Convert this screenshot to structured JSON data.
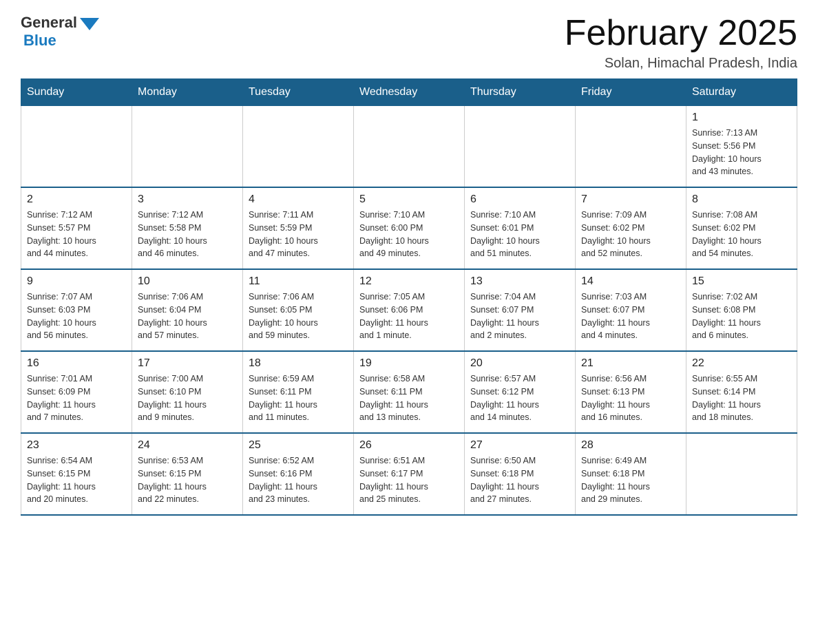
{
  "logo": {
    "general": "General",
    "blue": "Blue"
  },
  "title": "February 2025",
  "subtitle": "Solan, Himachal Pradesh, India",
  "days_of_week": [
    "Sunday",
    "Monday",
    "Tuesday",
    "Wednesday",
    "Thursday",
    "Friday",
    "Saturday"
  ],
  "weeks": [
    [
      {
        "day": "",
        "info": ""
      },
      {
        "day": "",
        "info": ""
      },
      {
        "day": "",
        "info": ""
      },
      {
        "day": "",
        "info": ""
      },
      {
        "day": "",
        "info": ""
      },
      {
        "day": "",
        "info": ""
      },
      {
        "day": "1",
        "info": "Sunrise: 7:13 AM\nSunset: 5:56 PM\nDaylight: 10 hours\nand 43 minutes."
      }
    ],
    [
      {
        "day": "2",
        "info": "Sunrise: 7:12 AM\nSunset: 5:57 PM\nDaylight: 10 hours\nand 44 minutes."
      },
      {
        "day": "3",
        "info": "Sunrise: 7:12 AM\nSunset: 5:58 PM\nDaylight: 10 hours\nand 46 minutes."
      },
      {
        "day": "4",
        "info": "Sunrise: 7:11 AM\nSunset: 5:59 PM\nDaylight: 10 hours\nand 47 minutes."
      },
      {
        "day": "5",
        "info": "Sunrise: 7:10 AM\nSunset: 6:00 PM\nDaylight: 10 hours\nand 49 minutes."
      },
      {
        "day": "6",
        "info": "Sunrise: 7:10 AM\nSunset: 6:01 PM\nDaylight: 10 hours\nand 51 minutes."
      },
      {
        "day": "7",
        "info": "Sunrise: 7:09 AM\nSunset: 6:02 PM\nDaylight: 10 hours\nand 52 minutes."
      },
      {
        "day": "8",
        "info": "Sunrise: 7:08 AM\nSunset: 6:02 PM\nDaylight: 10 hours\nand 54 minutes."
      }
    ],
    [
      {
        "day": "9",
        "info": "Sunrise: 7:07 AM\nSunset: 6:03 PM\nDaylight: 10 hours\nand 56 minutes."
      },
      {
        "day": "10",
        "info": "Sunrise: 7:06 AM\nSunset: 6:04 PM\nDaylight: 10 hours\nand 57 minutes."
      },
      {
        "day": "11",
        "info": "Sunrise: 7:06 AM\nSunset: 6:05 PM\nDaylight: 10 hours\nand 59 minutes."
      },
      {
        "day": "12",
        "info": "Sunrise: 7:05 AM\nSunset: 6:06 PM\nDaylight: 11 hours\nand 1 minute."
      },
      {
        "day": "13",
        "info": "Sunrise: 7:04 AM\nSunset: 6:07 PM\nDaylight: 11 hours\nand 2 minutes."
      },
      {
        "day": "14",
        "info": "Sunrise: 7:03 AM\nSunset: 6:07 PM\nDaylight: 11 hours\nand 4 minutes."
      },
      {
        "day": "15",
        "info": "Sunrise: 7:02 AM\nSunset: 6:08 PM\nDaylight: 11 hours\nand 6 minutes."
      }
    ],
    [
      {
        "day": "16",
        "info": "Sunrise: 7:01 AM\nSunset: 6:09 PM\nDaylight: 11 hours\nand 7 minutes."
      },
      {
        "day": "17",
        "info": "Sunrise: 7:00 AM\nSunset: 6:10 PM\nDaylight: 11 hours\nand 9 minutes."
      },
      {
        "day": "18",
        "info": "Sunrise: 6:59 AM\nSunset: 6:11 PM\nDaylight: 11 hours\nand 11 minutes."
      },
      {
        "day": "19",
        "info": "Sunrise: 6:58 AM\nSunset: 6:11 PM\nDaylight: 11 hours\nand 13 minutes."
      },
      {
        "day": "20",
        "info": "Sunrise: 6:57 AM\nSunset: 6:12 PM\nDaylight: 11 hours\nand 14 minutes."
      },
      {
        "day": "21",
        "info": "Sunrise: 6:56 AM\nSunset: 6:13 PM\nDaylight: 11 hours\nand 16 minutes."
      },
      {
        "day": "22",
        "info": "Sunrise: 6:55 AM\nSunset: 6:14 PM\nDaylight: 11 hours\nand 18 minutes."
      }
    ],
    [
      {
        "day": "23",
        "info": "Sunrise: 6:54 AM\nSunset: 6:15 PM\nDaylight: 11 hours\nand 20 minutes."
      },
      {
        "day": "24",
        "info": "Sunrise: 6:53 AM\nSunset: 6:15 PM\nDaylight: 11 hours\nand 22 minutes."
      },
      {
        "day": "25",
        "info": "Sunrise: 6:52 AM\nSunset: 6:16 PM\nDaylight: 11 hours\nand 23 minutes."
      },
      {
        "day": "26",
        "info": "Sunrise: 6:51 AM\nSunset: 6:17 PM\nDaylight: 11 hours\nand 25 minutes."
      },
      {
        "day": "27",
        "info": "Sunrise: 6:50 AM\nSunset: 6:18 PM\nDaylight: 11 hours\nand 27 minutes."
      },
      {
        "day": "28",
        "info": "Sunrise: 6:49 AM\nSunset: 6:18 PM\nDaylight: 11 hours\nand 29 minutes."
      },
      {
        "day": "",
        "info": ""
      }
    ]
  ]
}
